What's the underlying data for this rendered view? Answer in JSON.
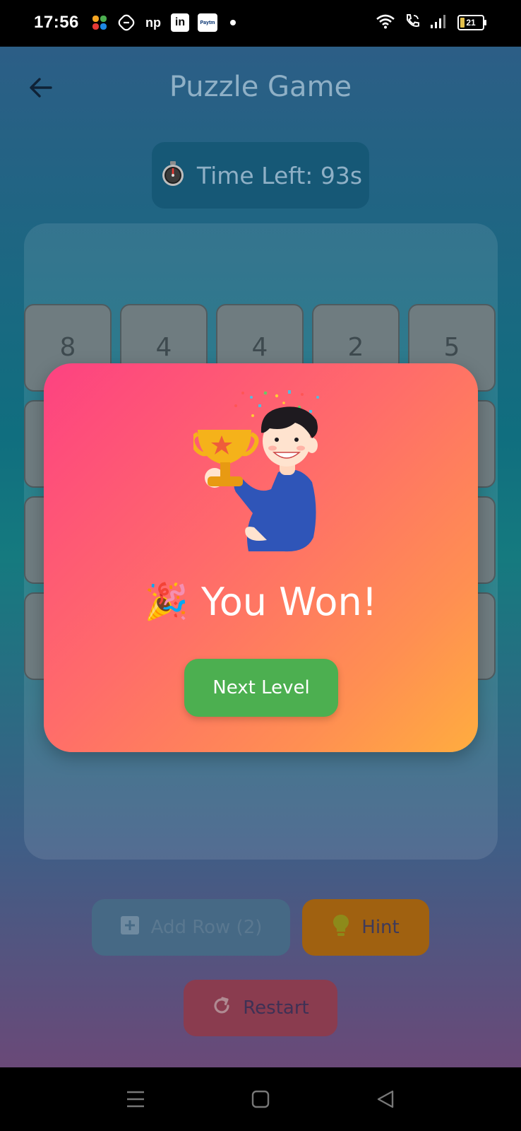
{
  "status_bar": {
    "time": "17:56",
    "apps": [
      {
        "icon": "pinwheel-app-icon"
      },
      {
        "icon": "shield-app-icon"
      },
      {
        "icon": "np-app-icon",
        "label": "np"
      },
      {
        "icon": "linkedin-app-icon",
        "label": "in"
      },
      {
        "icon": "paytm-app-icon",
        "label": "Paytm"
      }
    ],
    "battery_level": "21"
  },
  "header": {
    "title": "Puzzle Game"
  },
  "timer": {
    "label": "Time Left: 93s"
  },
  "board": {
    "visible_tiles": [
      "8",
      "4",
      "4",
      "2",
      "5"
    ]
  },
  "controls": {
    "add_row_label": "Add Row (2)",
    "hint_label": "Hint",
    "restart_label": "Restart"
  },
  "modal": {
    "title": "You Won!",
    "emoji": "🎉",
    "next_label": "Next Level"
  },
  "colors": {
    "next_button": "#4caf50",
    "modal_gradient_start": "#fd4281",
    "modal_gradient_end": "#ffad3f"
  }
}
